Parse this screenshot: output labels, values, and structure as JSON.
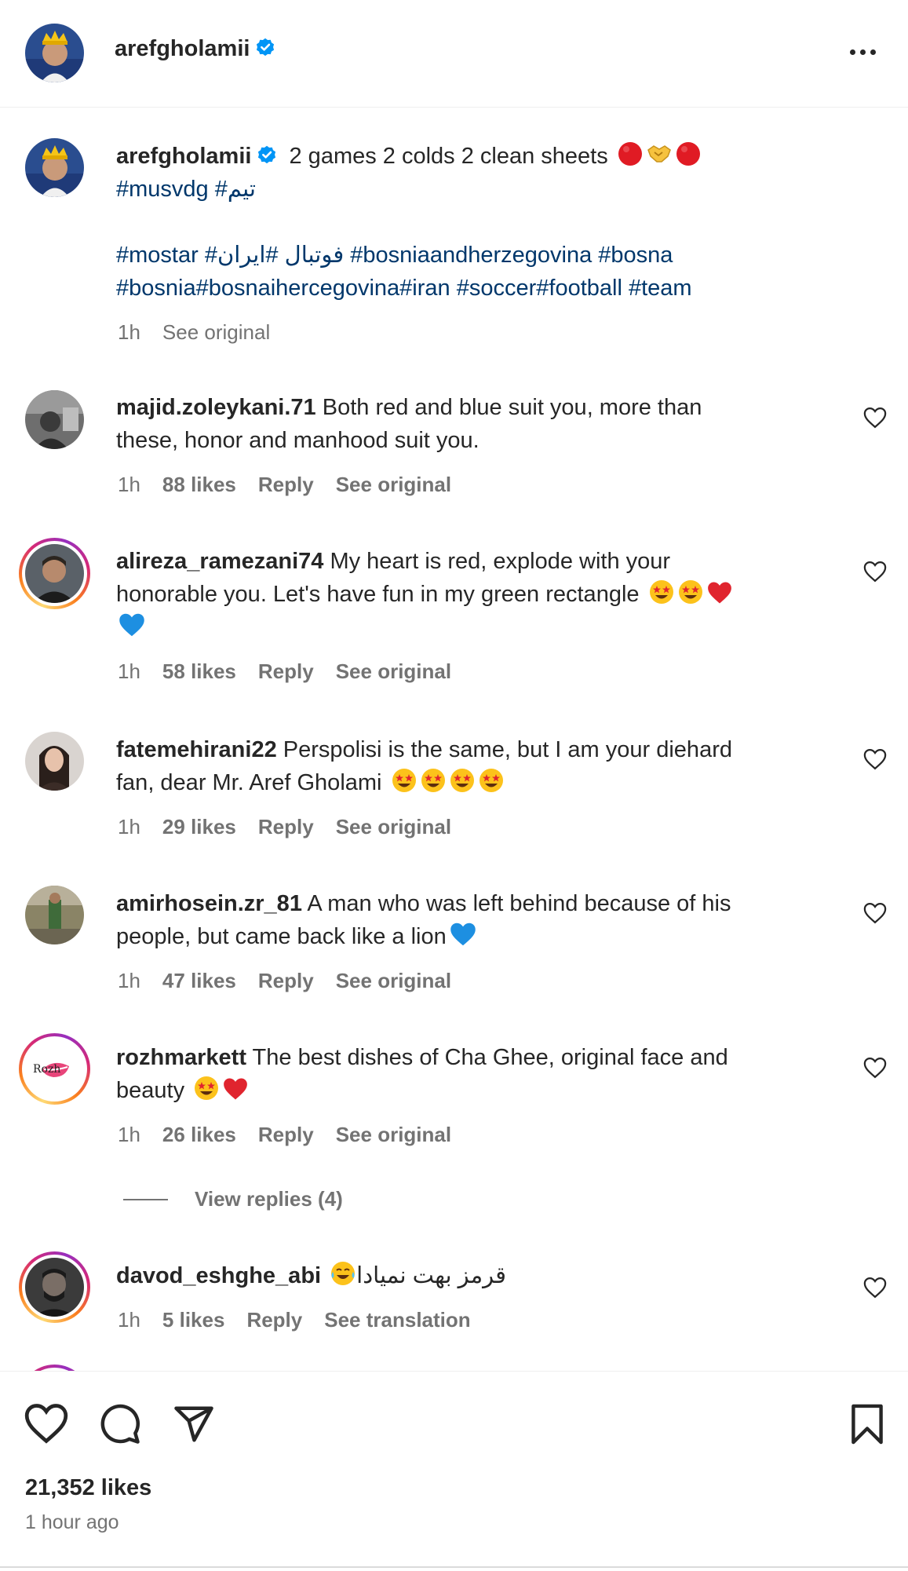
{
  "header": {
    "username": "arefgholamii"
  },
  "caption": {
    "username": "arefgholamii",
    "text": "2 games 2 colds 2 clean sheets",
    "hashtags_line1": "#musvdg #تیم",
    "hashtags_line2": "#mostar #فوتبال #ایران #bosniaandherzegovina #bosna",
    "hashtags_line3": "#bosnia#bosnaihercegovina#iran #soccer#football #team",
    "time": "1h",
    "see_original": "See original"
  },
  "comments": [
    {
      "username": "majid.zoleykani.71",
      "text_line1": "Both red and blue suit you, more than",
      "text_line2": "these, honor and manhood suit you.",
      "time": "1h",
      "likes": "88 likes",
      "reply": "Reply",
      "see_original": "See original"
    },
    {
      "username": "alireza_ramezani74",
      "text_line1": "My heart is red, explode with your",
      "text_line2": "honorable you. Let's have fun in my green rectangle",
      "time": "1h",
      "likes": "58 likes",
      "reply": "Reply",
      "see_original": "See original"
    },
    {
      "username": "fatemehirani22",
      "text_line1": "Perspolisi is the same, but I am your diehard",
      "text_line2": "fan, dear Mr. Aref Gholami",
      "time": "1h",
      "likes": "29 likes",
      "reply": "Reply",
      "see_original": "See original"
    },
    {
      "username": "amirhosein.zr_81",
      "text_line1": "A man who was left behind because of his",
      "text_line2": "people, but came back like a lion",
      "time": "1h",
      "likes": "47 likes",
      "reply": "Reply",
      "see_original": "See original"
    },
    {
      "username": "rozhmarkett",
      "text_line1": "The best dishes of Cha Ghee, original face and",
      "text_line2": "beauty",
      "time": "1h",
      "likes": "26 likes",
      "reply": "Reply",
      "see_original": "See original",
      "avatar_text": "Rozh"
    },
    {
      "username": "davod_eshghe_abi",
      "text_line1": "قرمز بهت نمیادا",
      "time": "1h",
      "likes": "5 likes",
      "reply": "Reply",
      "see_translation": "See translation"
    }
  ],
  "view_replies": "View replies (4)",
  "footer": {
    "likes": "21,352 likes",
    "time_ago": "1 hour ago"
  },
  "icons": {
    "verified": "verified-badge-icon",
    "more": "more-options-icon",
    "like": "heart-icon",
    "comment": "comment-icon",
    "share": "send-icon",
    "save": "bookmark-icon"
  },
  "colors": {
    "verified_blue": "#0095f6",
    "hashtag_blue": "#00376b",
    "muted": "#737373",
    "heart_red": "#e0242e",
    "circle_red": "#e01b24"
  }
}
